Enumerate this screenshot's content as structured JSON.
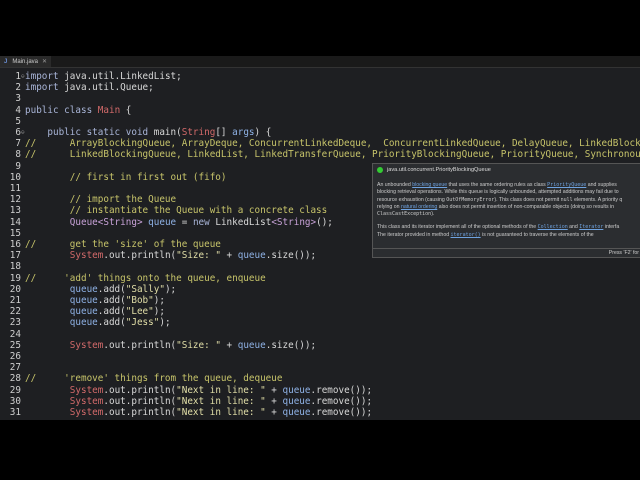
{
  "tab": {
    "icon": "J",
    "label": "Main.java",
    "close": "✕"
  },
  "code": [
    {
      "n": "1",
      "m": "⊖",
      "t": [
        [
          "import",
          "kw"
        ],
        [
          " java.util.LinkedList;",
          "pl"
        ]
      ]
    },
    {
      "n": "2",
      "t": [
        [
          "import",
          "kw"
        ],
        [
          " java.util.Queue;",
          "pl"
        ]
      ]
    },
    {
      "n": "3",
      "t": []
    },
    {
      "n": "4",
      "t": [
        [
          "public class",
          "kw"
        ],
        [
          " ",
          "pl"
        ],
        [
          "Main",
          "cls"
        ],
        [
          " {",
          "pl"
        ]
      ]
    },
    {
      "n": "5",
      "t": []
    },
    {
      "n": "6",
      "m": "⊖",
      "t": [
        [
          "    public static void",
          "kw"
        ],
        [
          " main(",
          "pl"
        ],
        [
          "String",
          "cls"
        ],
        [
          "[] ",
          "pl"
        ],
        [
          "args",
          "fld"
        ],
        [
          ") {",
          "pl"
        ]
      ]
    },
    {
      "n": "7",
      "t": [
        [
          "//      ArrayBlockingQueue, ArrayDeque, ConcurrentLinkedDeque,  ConcurrentLinkedQueue, DelayQueue, LinkedBlock",
          "cm"
        ]
      ]
    },
    {
      "n": "8",
      "t": [
        [
          "//      LinkedBlockingQueue, LinkedList, LinkedTransferQueue, PriorityBlockingQueue, PriorityQueue, Synchronou",
          "cm"
        ]
      ]
    },
    {
      "n": "9",
      "t": []
    },
    {
      "n": "10",
      "t": [
        [
          "        // first in first out (fifo)",
          "cm"
        ]
      ]
    },
    {
      "n": "11",
      "t": []
    },
    {
      "n": "12",
      "t": [
        [
          "        // import the Queue",
          "cm"
        ]
      ]
    },
    {
      "n": "13",
      "t": [
        [
          "        // instantiate the Queue with a concrete class",
          "cm"
        ]
      ]
    },
    {
      "n": "14",
      "t": [
        [
          "        Queue<String>",
          "ty"
        ],
        [
          " ",
          "pl"
        ],
        [
          "queue",
          "fld"
        ],
        [
          " = ",
          "pl"
        ],
        [
          "new",
          "kw"
        ],
        [
          " LinkedList",
          "pl"
        ],
        [
          "<String>",
          "ty"
        ],
        [
          "();",
          "pl"
        ]
      ]
    },
    {
      "n": "15",
      "t": []
    },
    {
      "n": "16",
      "t": [
        [
          "//      get the 'size' of the queue",
          "cm"
        ]
      ]
    },
    {
      "n": "17",
      "t": [
        [
          "        System",
          "cls"
        ],
        [
          ".out.println(",
          "pl"
        ],
        [
          "\"Size: \"",
          "str"
        ],
        [
          " + ",
          "pl"
        ],
        [
          "queue",
          "fld"
        ],
        [
          ".size());",
          "pl"
        ]
      ]
    },
    {
      "n": "18",
      "t": []
    },
    {
      "n": "19",
      "t": [
        [
          "//     'add' things onto the queue, enqueue",
          "cm"
        ]
      ]
    },
    {
      "n": "20",
      "t": [
        [
          "        queue",
          "fld"
        ],
        [
          ".add(",
          "pl"
        ],
        [
          "\"Sally\"",
          "str"
        ],
        [
          ");",
          "pl"
        ]
      ]
    },
    {
      "n": "21",
      "t": [
        [
          "        queue",
          "fld"
        ],
        [
          ".add(",
          "pl"
        ],
        [
          "\"Bob\"",
          "str"
        ],
        [
          ");",
          "pl"
        ]
      ]
    },
    {
      "n": "22",
      "t": [
        [
          "        queue",
          "fld"
        ],
        [
          ".add(",
          "pl"
        ],
        [
          "\"Lee\"",
          "str"
        ],
        [
          ");",
          "pl"
        ]
      ]
    },
    {
      "n": "23",
      "t": [
        [
          "        queue",
          "fld"
        ],
        [
          ".add(",
          "pl"
        ],
        [
          "\"Jess\"",
          "str"
        ],
        [
          ");",
          "pl"
        ]
      ]
    },
    {
      "n": "24",
      "t": []
    },
    {
      "n": "25",
      "t": [
        [
          "        System",
          "cls"
        ],
        [
          ".out.println(",
          "pl"
        ],
        [
          "\"Size: \"",
          "str"
        ],
        [
          " + ",
          "pl"
        ],
        [
          "queue",
          "fld"
        ],
        [
          ".size());",
          "pl"
        ]
      ]
    },
    {
      "n": "26",
      "t": []
    },
    {
      "n": "27",
      "t": []
    },
    {
      "n": "28",
      "t": [
        [
          "//     'remove' things from the queue, dequeue",
          "cm"
        ]
      ]
    },
    {
      "n": "29",
      "t": [
        [
          "        System",
          "cls"
        ],
        [
          ".out.println(",
          "pl"
        ],
        [
          "\"Next in line: \"",
          "str"
        ],
        [
          " + ",
          "pl"
        ],
        [
          "queue",
          "fld"
        ],
        [
          ".remove());",
          "pl"
        ]
      ]
    },
    {
      "n": "30",
      "t": [
        [
          "        System",
          "cls"
        ],
        [
          ".out.println(",
          "pl"
        ],
        [
          "\"Next in line: \"",
          "str"
        ],
        [
          " + ",
          "pl"
        ],
        [
          "queue",
          "fld"
        ],
        [
          ".remove());",
          "pl"
        ]
      ]
    },
    {
      "n": "31",
      "t": [
        [
          "        System",
          "cls"
        ],
        [
          ".out.println(",
          "pl"
        ],
        [
          "\"Next in line: \"",
          "str"
        ],
        [
          " + ",
          "pl"
        ],
        [
          "queue",
          "fld"
        ],
        [
          ".remove());",
          "pl"
        ]
      ]
    }
  ],
  "tooltip": {
    "title": "java.util.concurrent.PriorityBlockingQueue",
    "p1": [
      [
        "An unbounded ",
        ""
      ],
      [
        "blocking queue",
        "lnk"
      ],
      [
        " that uses the same ordering rules as class ",
        ""
      ],
      [
        "PriorityQueue",
        "lnk mono"
      ],
      [
        " and supplies",
        ""
      ],
      [
        "\n",
        ""
      ],
      [
        "blocking retrieval operations. While this queue is logically unbounded, attempted additions may fail due to",
        ""
      ],
      [
        "\n",
        ""
      ],
      [
        "resource exhaustion (causing ",
        ""
      ],
      [
        "OutOfMemoryError",
        "mono"
      ],
      [
        "). This class does not permit ",
        ""
      ],
      [
        "null",
        "mono"
      ],
      [
        " elements. A priority q",
        ""
      ],
      [
        "\n",
        ""
      ],
      [
        "relying on ",
        ""
      ],
      [
        "natural ordering",
        "lnk"
      ],
      [
        " also does not permit insertion of non-comparable objects (doing so results in",
        ""
      ],
      [
        "\n",
        ""
      ],
      [
        "ClassCastException",
        "mono"
      ],
      [
        ").",
        ""
      ]
    ],
    "p2": [
      [
        "This class and its iterator implement all of the optional methods of the ",
        ""
      ],
      [
        "Collection",
        "lnk mono"
      ],
      [
        " and ",
        ""
      ],
      [
        "Iterator",
        "lnk mono"
      ],
      [
        " interfa",
        ""
      ],
      [
        "\n",
        ""
      ],
      [
        "The iterator provided in method ",
        ""
      ],
      [
        "iterator()",
        "lnk mono"
      ],
      [
        " is not guaranteed to traverse the elements of the",
        ""
      ]
    ],
    "footer": "Press 'F2' for"
  }
}
